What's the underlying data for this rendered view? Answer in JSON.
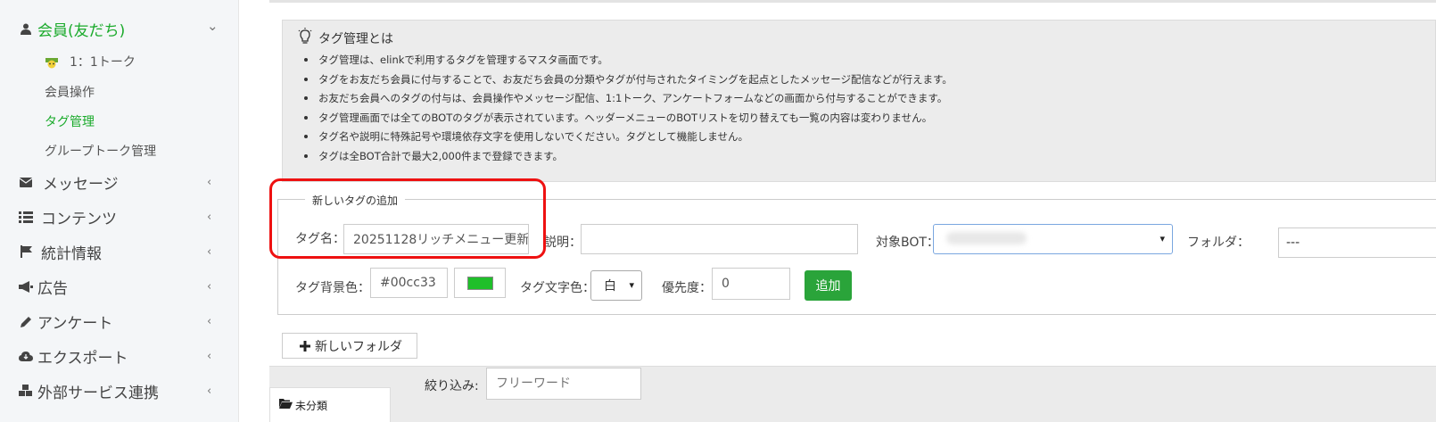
{
  "sidebar": {
    "members": "会員(友だち)",
    "members_chevron": "⌄",
    "sub_items": [
      "1：1トーク",
      "会員操作",
      "タグ管理",
      "グループトーク管理"
    ],
    "items": [
      {
        "label": "メッセージ",
        "icon": "envelope-icon"
      },
      {
        "label": "コンテンツ",
        "icon": "list-icon"
      },
      {
        "label": "統計情報",
        "icon": "flag-icon"
      },
      {
        "label": "広告",
        "icon": "megaphone-icon"
      },
      {
        "label": "アンケート",
        "icon": "pencil-icon"
      },
      {
        "label": "エクスポート",
        "icon": "cloud-download-icon"
      },
      {
        "label": "外部サービス連携",
        "icon": "cubes-icon"
      }
    ],
    "chevron": "‹"
  },
  "info": {
    "title": "タグ管理とは",
    "bullets": [
      "タグ管理は、elinkで利用するタグを管理するマスタ画面です。",
      "タグをお友だち会員に付与することで、お友だち会員の分類やタグが付与されたタイミングを起点としたメッセージ配信などが行えます。",
      "お友だち会員へのタグの付与は、会員操作やメッセージ配信、1:1トーク、アンケートフォームなどの画面から付与することができます。",
      "タグ管理画面では全てのBOTのタグが表示されています。ヘッダーメニューのBOTリストを切り替えても一覧の内容は変わりません。",
      "タグ名や説明に特殊記号や環境依存文字を使用しないでください。タグとして機能しません。",
      "タグは全BOT合計で最大2,000件まで登録できます。"
    ]
  },
  "form": {
    "legend": "新しいタグの追加",
    "tag_name_label": "タグ名：",
    "tag_name_value": "20251128リッチメニュー更新",
    "description_label": "説明：",
    "description_value": "",
    "target_bot_label": "対象BOT：",
    "folder_label": "フォルダ：",
    "folder_value": "---",
    "bg_color_label": "タグ背景色：",
    "bg_color_value": "#00cc33",
    "swatch_color": "#1fbf2a",
    "text_color_label": "タグ文字色：",
    "text_color_value": "白",
    "priority_label": "優先度：",
    "priority_value": "0",
    "add_button": "追加",
    "accent_green": "#2aa43a",
    "highlight_red": "#ee1111"
  },
  "new_folder_button": "新しいフォルダ",
  "filter": {
    "label": "絞り込み:",
    "placeholder": "フリーワード"
  },
  "folder_tab": "未分類"
}
